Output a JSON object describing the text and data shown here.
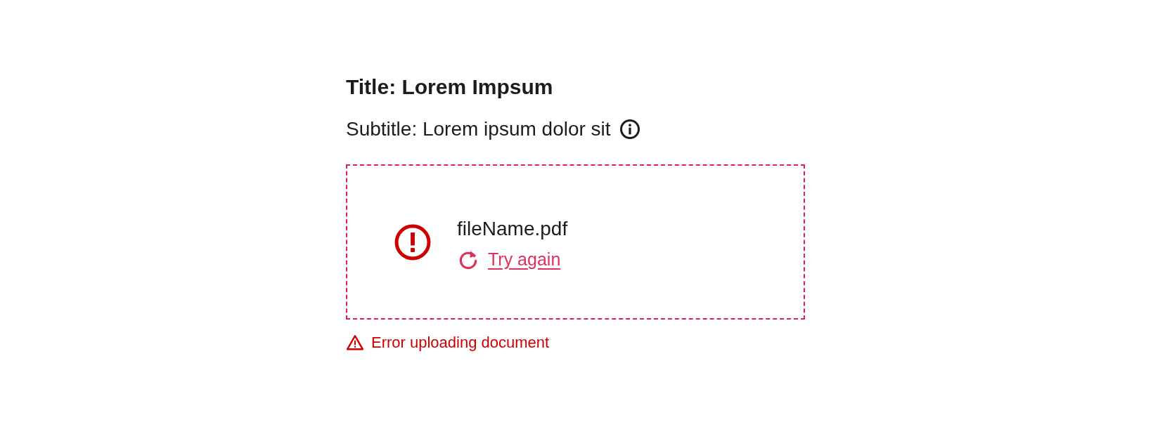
{
  "title": "Title: Lorem Impsum",
  "subtitle": "Subtitle: Lorem ipsum dolor sit",
  "upload": {
    "failed": true,
    "file_name": "fileName.pdf",
    "action": "Try again"
  },
  "error_message": "Error uploading document"
}
